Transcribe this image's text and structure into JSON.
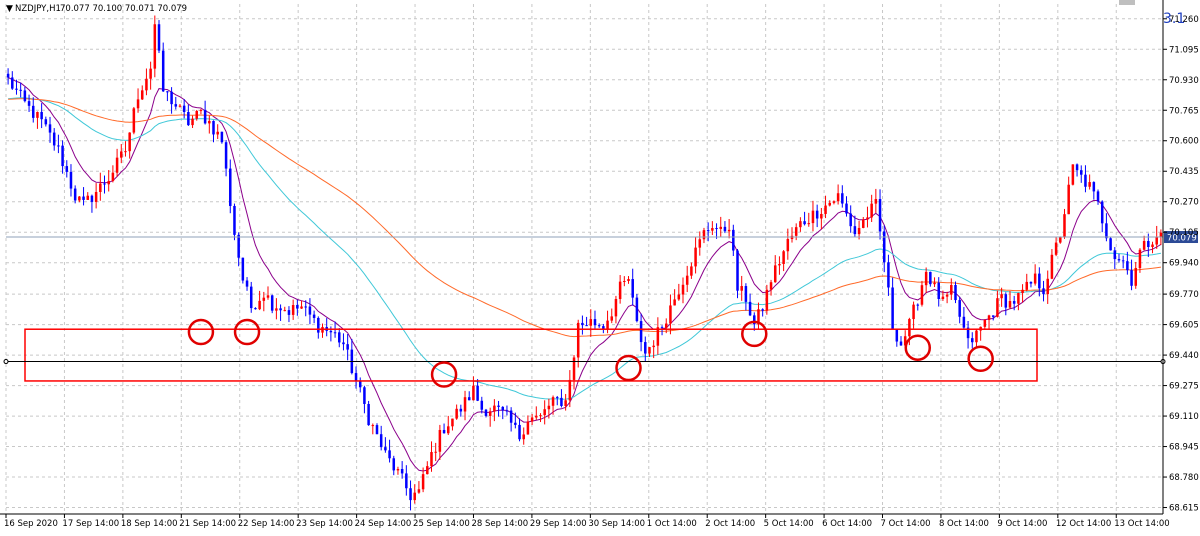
{
  "window": {
    "title": "NZDJPY,H1",
    "ohlc": "70.077 70.100 70.071 70.079",
    "badge": "3.1"
  },
  "colors": {
    "bull": "#ff0000",
    "bear": "#0000ff",
    "grid": "#c8c8c8",
    "ma_fast": "#8b008b",
    "ma_mid": "#40c8d8",
    "ma_slow": "#ff6a2a",
    "zone": "#ff0000",
    "marker": "#e00000",
    "support_line": "#000000",
    "price_tag_bg": "#2c4a96",
    "price_line": "#8fa0b8"
  },
  "chart_data": {
    "type": "candlestick",
    "symbol": "NZDJPY",
    "timeframe": "H1",
    "last_price": "70.079",
    "grid": true,
    "y_ticks": [
      "71.260",
      "71.095",
      "70.930",
      "70.765",
      "70.600",
      "70.435",
      "70.270",
      "70.105",
      "69.940",
      "69.770",
      "69.605",
      "69.440",
      "69.275",
      "69.110",
      "68.945",
      "68.780",
      "68.615"
    ],
    "ylim": [
      68.58,
      71.34
    ],
    "x_ticks": [
      "16 Sep 2020",
      "17 Sep 14:00",
      "18 Sep 14:00",
      "21 Sep 14:00",
      "22 Sep 14:00",
      "23 Sep 14:00",
      "24 Sep 14:00",
      "25 Sep 14:00",
      "28 Sep 14:00",
      "29 Sep 14:00",
      "30 Sep 14:00",
      "1 Oct 14:00",
      "2 Oct 14:00",
      "5 Oct 14:00",
      "6 Oct 14:00",
      "7 Oct 14:00",
      "8 Oct 14:00",
      "9 Oct 14:00",
      "12 Oct 14:00",
      "13 Oct 14:00"
    ],
    "price_path": [
      [
        0,
        70.93
      ],
      [
        4,
        70.8
      ],
      [
        8,
        70.7
      ],
      [
        12,
        70.55
      ],
      [
        16,
        70.3
      ],
      [
        18,
        70.25
      ],
      [
        20,
        70.3
      ],
      [
        24,
        70.4
      ],
      [
        28,
        70.55
      ],
      [
        31,
        70.85
      ],
      [
        34,
        71.0
      ],
      [
        35,
        71.23
      ],
      [
        37,
        70.87
      ],
      [
        39,
        70.82
      ],
      [
        43,
        70.7
      ],
      [
        46,
        70.75
      ],
      [
        48,
        70.7
      ],
      [
        51,
        70.6
      ],
      [
        54,
        70.1
      ],
      [
        56,
        69.85
      ],
      [
        58,
        69.7
      ],
      [
        61,
        69.78
      ],
      [
        63,
        69.72
      ],
      [
        67,
        69.68
      ],
      [
        70,
        69.7
      ],
      [
        74,
        69.6
      ],
      [
        78,
        69.55
      ],
      [
        80,
        69.5
      ],
      [
        83,
        69.3
      ],
      [
        86,
        69.1
      ],
      [
        90,
        68.9
      ],
      [
        93,
        68.8
      ],
      [
        96,
        68.68
      ],
      [
        98,
        68.7
      ],
      [
        101,
        68.9
      ],
      [
        104,
        69.05
      ],
      [
        108,
        69.15
      ],
      [
        111,
        69.25
      ],
      [
        113,
        69.15
      ],
      [
        116,
        69.15
      ],
      [
        119,
        69.1
      ],
      [
        122,
        69.0
      ],
      [
        124,
        69.1
      ],
      [
        127,
        69.1
      ],
      [
        130,
        69.2
      ],
      [
        132,
        69.15
      ],
      [
        134,
        69.3
      ],
      [
        136,
        69.6
      ],
      [
        139,
        69.62
      ],
      [
        142,
        69.6
      ],
      [
        144,
        69.68
      ],
      [
        146,
        69.8
      ],
      [
        148,
        69.85
      ],
      [
        150,
        69.6
      ],
      [
        152,
        69.45
      ],
      [
        154,
        69.52
      ],
      [
        156,
        69.6
      ],
      [
        159,
        69.75
      ],
      [
        162,
        69.9
      ],
      [
        164,
        70.0
      ],
      [
        166,
        70.1
      ],
      [
        168,
        70.15
      ],
      [
        170,
        70.1
      ],
      [
        172,
        70.15
      ],
      [
        174,
        69.8
      ],
      [
        176,
        69.75
      ],
      [
        178,
        69.6
      ],
      [
        180,
        69.7
      ],
      [
        182,
        69.85
      ],
      [
        184,
        69.95
      ],
      [
        186,
        70.05
      ],
      [
        189,
        70.15
      ],
      [
        192,
        70.2
      ],
      [
        195,
        70.25
      ],
      [
        198,
        70.3
      ],
      [
        200,
        70.2
      ],
      [
        202,
        70.1
      ],
      [
        205,
        70.2
      ],
      [
        207,
        70.25
      ],
      [
        209,
        69.95
      ],
      [
        211,
        69.6
      ],
      [
        213,
        69.5
      ],
      [
        215,
        69.6
      ],
      [
        217,
        69.75
      ],
      [
        219,
        69.9
      ],
      [
        221,
        69.8
      ],
      [
        223,
        69.72
      ],
      [
        225,
        69.78
      ],
      [
        227,
        69.65
      ],
      [
        229,
        69.5
      ],
      [
        231,
        69.55
      ],
      [
        233,
        69.62
      ],
      [
        235,
        69.68
      ],
      [
        237,
        69.75
      ],
      [
        239,
        69.72
      ],
      [
        241,
        69.75
      ],
      [
        243,
        69.8
      ],
      [
        245,
        69.85
      ],
      [
        247,
        69.8
      ],
      [
        249,
        69.95
      ],
      [
        251,
        70.1
      ],
      [
        254,
        70.45
      ],
      [
        256,
        70.4
      ],
      [
        258,
        70.35
      ],
      [
        260,
        70.25
      ],
      [
        262,
        70.1
      ],
      [
        264,
        69.98
      ],
      [
        266,
        69.95
      ],
      [
        268,
        69.85
      ],
      [
        270,
        70.0
      ],
      [
        272,
        70.05
      ],
      [
        274,
        70.1
      ],
      [
        275,
        70.08
      ]
    ],
    "zones": [
      {
        "label": "support-zone",
        "price_top": 69.58,
        "price_bottom": 69.3
      }
    ],
    "support_level": 69.405,
    "markers": [
      {
        "bar": 46,
        "price": 69.565
      },
      {
        "bar": 57,
        "price": 69.565
      },
      {
        "bar": 104,
        "price": 69.335
      },
      {
        "bar": 148,
        "price": 69.37
      },
      {
        "bar": 178,
        "price": 69.555
      },
      {
        "bar": 217,
        "price": 69.48
      },
      {
        "bar": 232,
        "price": 69.42
      }
    ],
    "bar_count": 276
  }
}
